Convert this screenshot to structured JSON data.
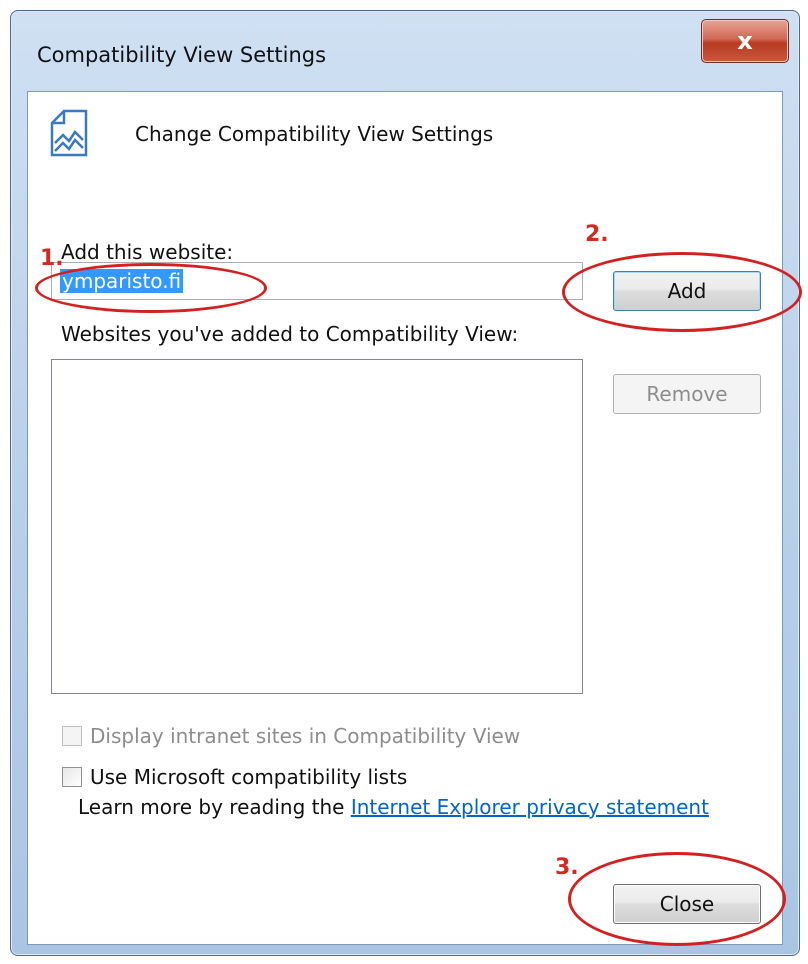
{
  "window": {
    "title": "Compatibility View Settings",
    "close_glyph": "x"
  },
  "header": {
    "icon": "compat-view-icon",
    "text": "Change Compatibility View Settings"
  },
  "add_section": {
    "label": "Add this website:",
    "input_value": "ymparisto.fi",
    "add_button": "Add"
  },
  "list_section": {
    "label": "Websites you've added to Compatibility View:",
    "items": [],
    "remove_button": "Remove"
  },
  "options": {
    "intranet_label": "Display intranet sites in Compatibility View",
    "intranet_checked": false,
    "intranet_enabled": false,
    "ms_lists_label": "Use Microsoft compatibility lists",
    "ms_lists_checked": false
  },
  "learn_more": {
    "prefix": "Learn more by reading the ",
    "link_text": "Internet Explorer privacy statement"
  },
  "footer": {
    "close_button": "Close"
  },
  "annotations": {
    "step1": "1.",
    "step2": "2.",
    "step3": "3.",
    "color": "#d42020"
  }
}
